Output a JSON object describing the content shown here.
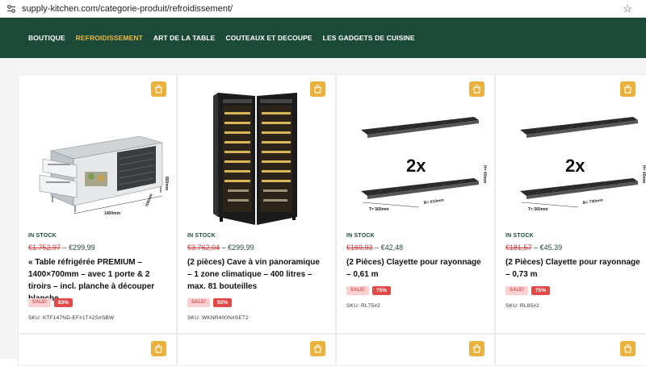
{
  "browser": {
    "url": "supply-kitchen.com/categorie-produit/refroidissement/",
    "site_info_icon": "tune-icon",
    "bookmark_icon": "star-icon"
  },
  "nav": {
    "items": [
      {
        "label": "BOUTIQUE",
        "active": false
      },
      {
        "label": "REFROIDISSEMENT",
        "active": true
      },
      {
        "label": "ART DE LA TABLE",
        "active": false
      },
      {
        "label": "COUTEAUX ET DECOUPE",
        "active": false
      },
      {
        "label": "LES GADGETS DE CUISINE",
        "active": false
      }
    ],
    "bg_color": "#1c4a38",
    "active_color": "#e8b642"
  },
  "products": [
    {
      "stock": "IN STOCK",
      "old_price": "€1.752,97",
      "sep": " – ",
      "new_price": "€299,99",
      "title": "« Table réfrigérée PREMIUM – 1400×700mm – avec 1 porte & 2 tiroirs – incl. planche à découper blanche",
      "sale": "SALE!",
      "discount": "83%",
      "sku": "SKU: KTF147ND-EF#1T#2S#SBW",
      "image": "refrigerated-table",
      "dims": {
        "w": "1400mm",
        "d": "700mm",
        "h": "850mm"
      }
    },
    {
      "stock": "IN STOCK",
      "old_price": "€3.762,04",
      "sep": " – ",
      "new_price": "€299,99",
      "title": "(2 pièces) Cave à vin panoramique – 1 zone climatique – 400 litres – max. 81 bouteilles",
      "sale": "SALE!",
      "discount": "92%",
      "sku": "SKU: WKNR400N#SET2",
      "image": "wine-cabinet"
    },
    {
      "stock": "IN STOCK",
      "old_price": "€169,93",
      "sep": " – ",
      "new_price": "€42,48",
      "title": "(2 Pièces) Clayette pour rayonnage – 0,61 m",
      "sale": "SALE!",
      "discount": "75%",
      "sku": "SKU: RL75#2",
      "image": "shelf",
      "dims": {
        "count": "2x",
        "t": "T= 560mm",
        "b": "B= 610mm",
        "h": "H= 40mm"
      }
    },
    {
      "stock": "IN STOCK",
      "old_price": "€181,57",
      "sep": " – ",
      "new_price": "€45,39",
      "title": "(2 Pièces) Clayette pour rayonnage – 0,73 m",
      "sale": "SALE!",
      "discount": "75%",
      "sku": "SKU: RL85#2",
      "image": "shelf",
      "dims": {
        "count": "2x",
        "t": "T= 560mm",
        "b": "B= 730mm",
        "h": "H= 40mm"
      }
    }
  ],
  "colors": {
    "accent": "#eab13c",
    "sale_red": "#e24a4a",
    "old_price": "#d23a3a"
  }
}
